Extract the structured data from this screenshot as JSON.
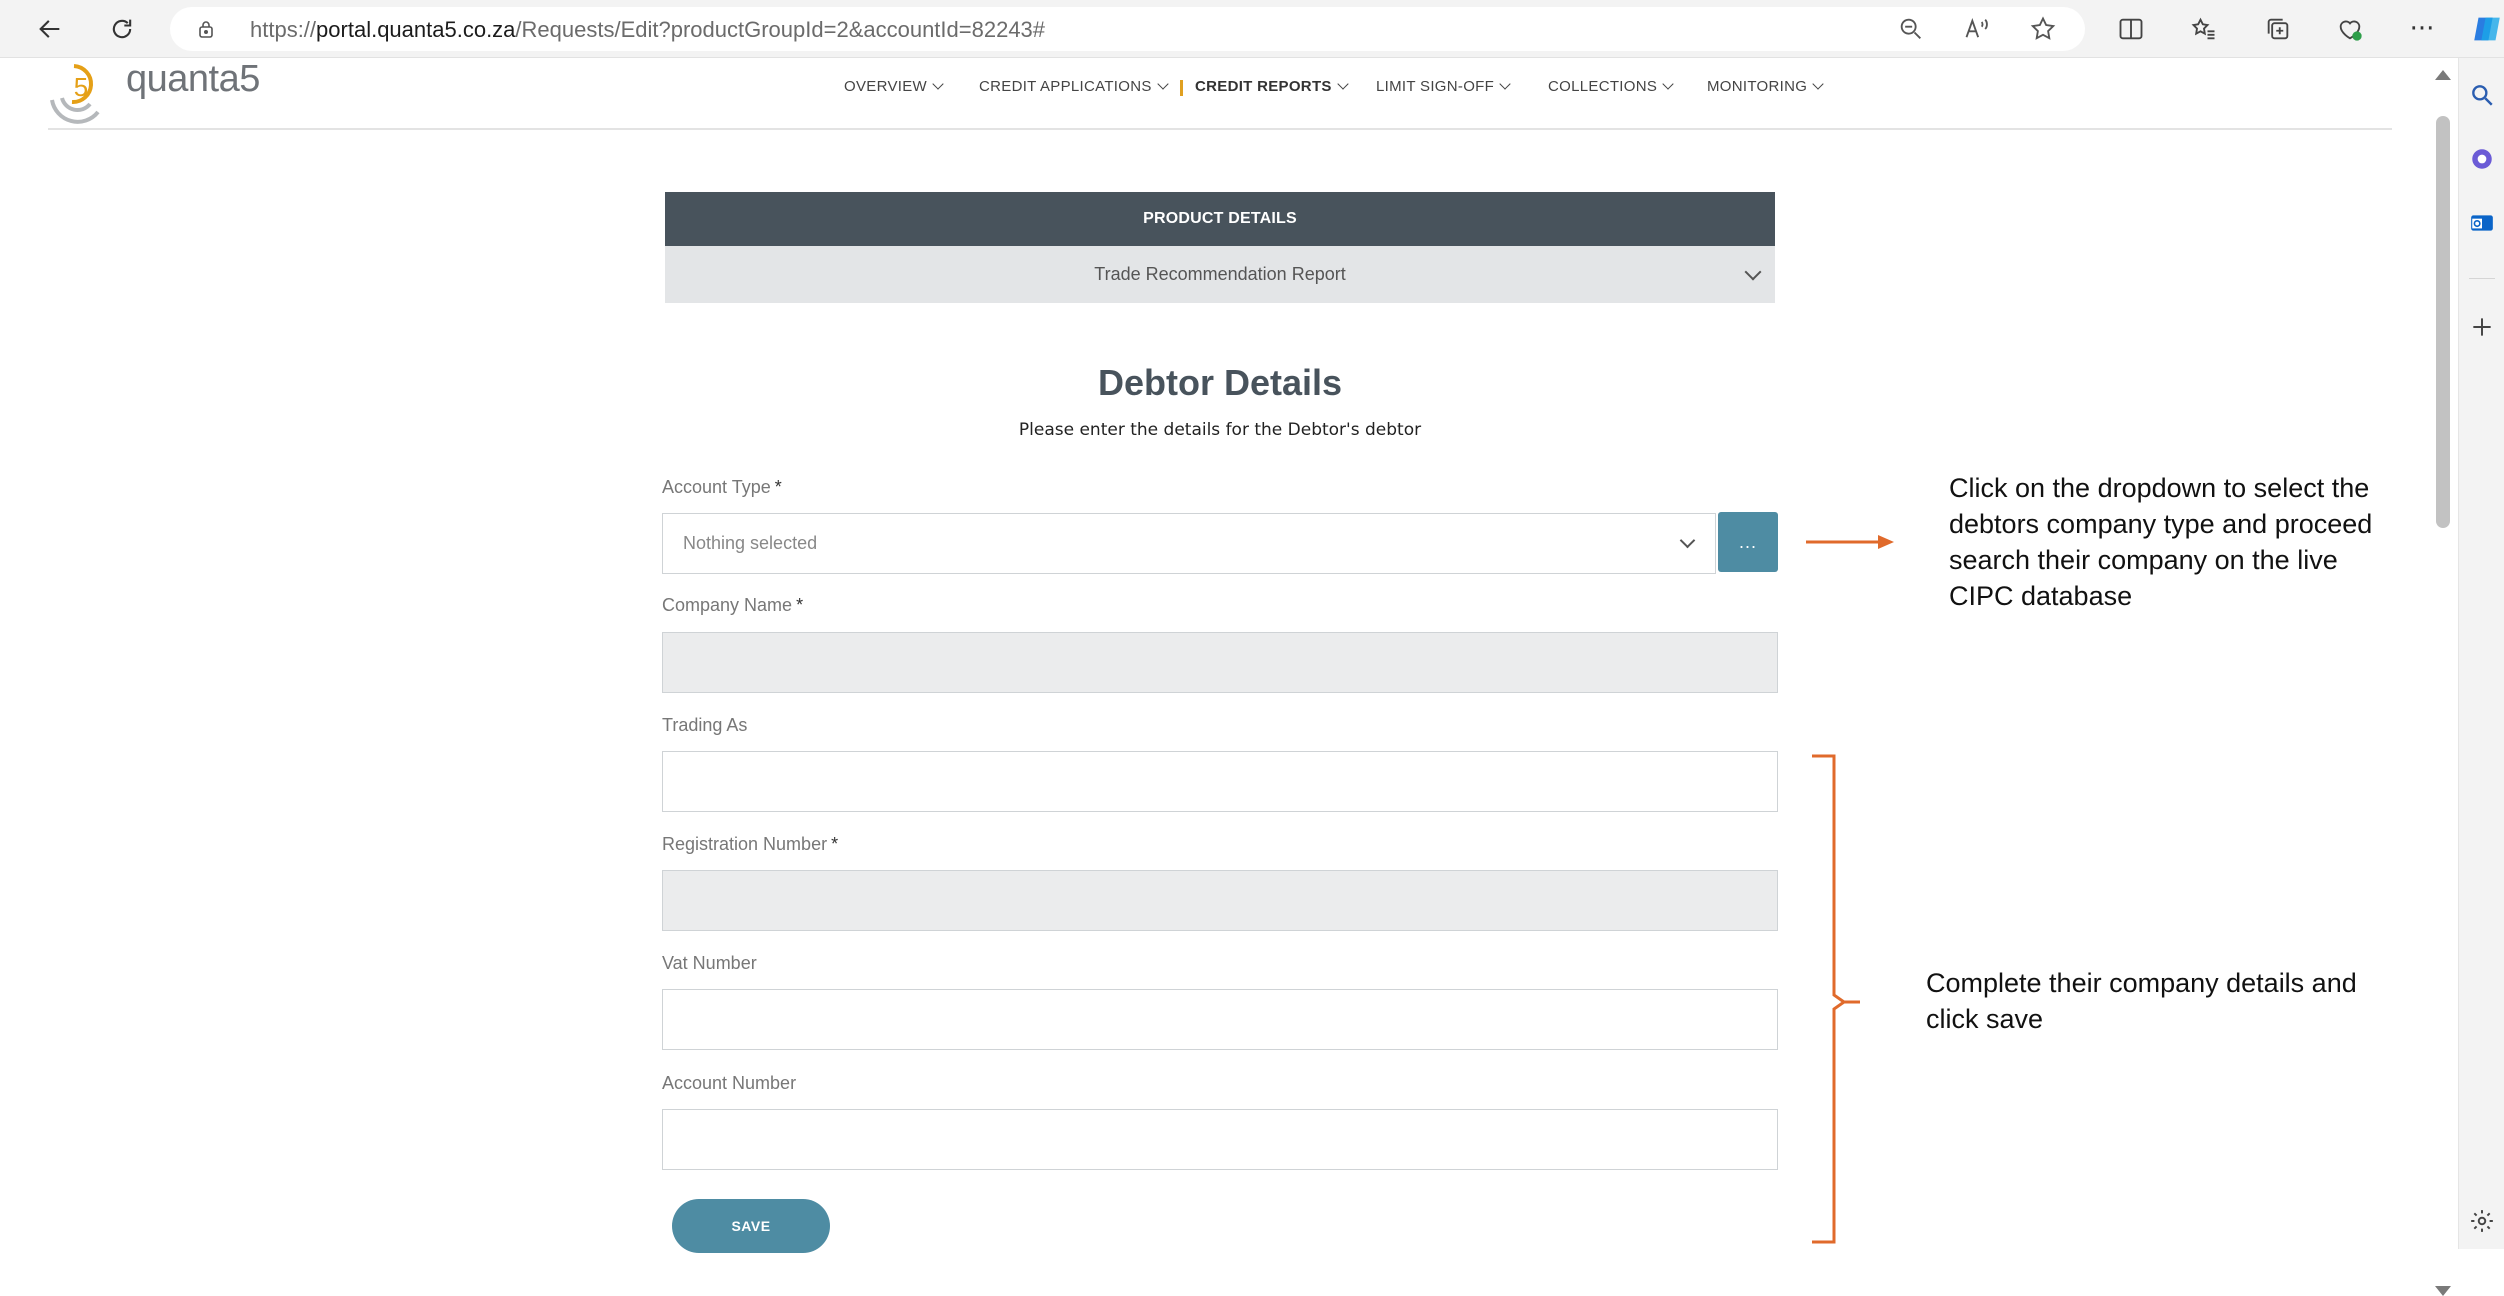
{
  "browser": {
    "url_prefix": "https://",
    "url_host": "portal.quanta5.co.za",
    "url_path": "/Requests/Edit?productGroupId=2&accountId=82243#"
  },
  "site": {
    "logo_text": "quanta5",
    "nav": [
      {
        "label": "OVERVIEW"
      },
      {
        "label": "CREDIT APPLICATIONS"
      },
      {
        "label": "CREDIT REPORTS"
      },
      {
        "label": "LIMIT SIGN-OFF"
      },
      {
        "label": "COLLECTIONS"
      },
      {
        "label": "MONITORING"
      }
    ]
  },
  "product": {
    "header": "PRODUCT DETAILS",
    "selected": "Trade Recommendation Report"
  },
  "form": {
    "title": "Debtor Details",
    "subtitle": "Please enter the details for the Debtor's debtor",
    "account_type_label": "Account Type",
    "account_type_value": "Nothing selected",
    "lookup_button": "...",
    "company_name_label": "Company Name",
    "trading_as_label": "Trading As",
    "registration_label": "Registration Number",
    "vat_label": "Vat Number",
    "account_number_label": "Account Number",
    "required_mark": "*",
    "save_label": "SAVE"
  },
  "annotations": {
    "note1": "Click on the dropdown to select the debtors company type and proceed search their company on the live CIPC database",
    "note2": "Complete their company details and click save",
    "color": "#e06a2b"
  }
}
